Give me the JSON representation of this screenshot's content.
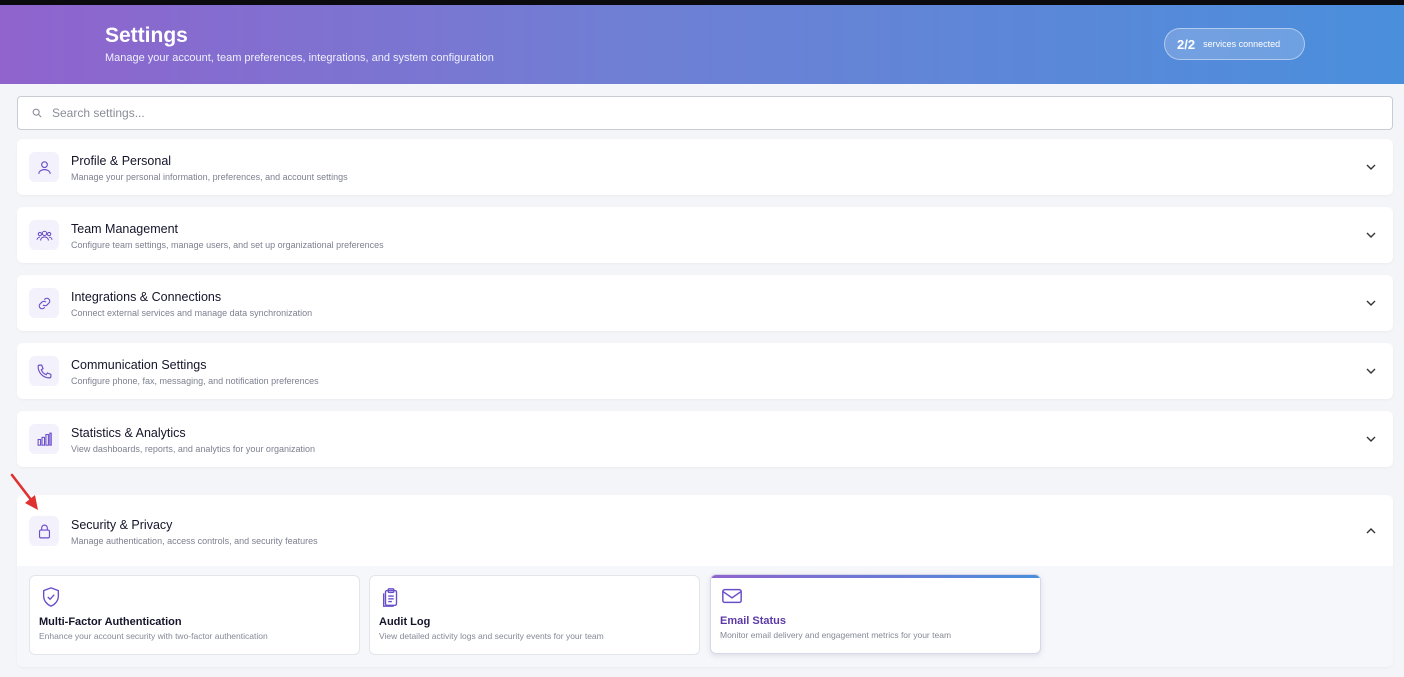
{
  "header": {
    "title": "Settings",
    "subtitle": "Manage your account, team preferences, integrations, and system configuration",
    "badge_count": "2/2",
    "badge_label": "services connected"
  },
  "search": {
    "placeholder": "Search settings..."
  },
  "sections": [
    {
      "title": "Profile & Personal",
      "description": "Manage your personal information, preferences, and account settings",
      "icon": "user-icon",
      "expanded": false
    },
    {
      "title": "Team Management",
      "description": "Configure team settings, manage users, and set up organizational preferences",
      "icon": "team-icon",
      "expanded": false
    },
    {
      "title": "Integrations & Connections",
      "description": "Connect external services and manage data synchronization",
      "icon": "link-icon",
      "expanded": false
    },
    {
      "title": "Communication Settings",
      "description": "Configure phone, fax, messaging, and notification preferences",
      "icon": "phone-icon",
      "expanded": false
    },
    {
      "title": "Statistics & Analytics",
      "description": "View dashboards, reports, and analytics for your organization",
      "icon": "bar-chart-icon",
      "expanded": false
    },
    {
      "title": "Security & Privacy",
      "description": "Manage authentication, access controls, and security features",
      "icon": "lock-icon",
      "expanded": true,
      "cards": [
        {
          "title": "Multi-Factor Authentication",
          "description": "Enhance your account security with two-factor authentication",
          "icon": "shield-check-icon"
        },
        {
          "title": "Audit Log",
          "description": "View detailed activity logs and security events for your team",
          "icon": "clipboard-icon"
        },
        {
          "title": "Email Status",
          "description": "Monitor email delivery and engagement metrics for your team",
          "icon": "mail-icon",
          "active": true
        }
      ]
    }
  ],
  "colors": {
    "accent": "#6b4fc9",
    "header_start": "#9063cd",
    "header_end": "#4a8fdc",
    "annotation_arrow": "#e03131"
  }
}
